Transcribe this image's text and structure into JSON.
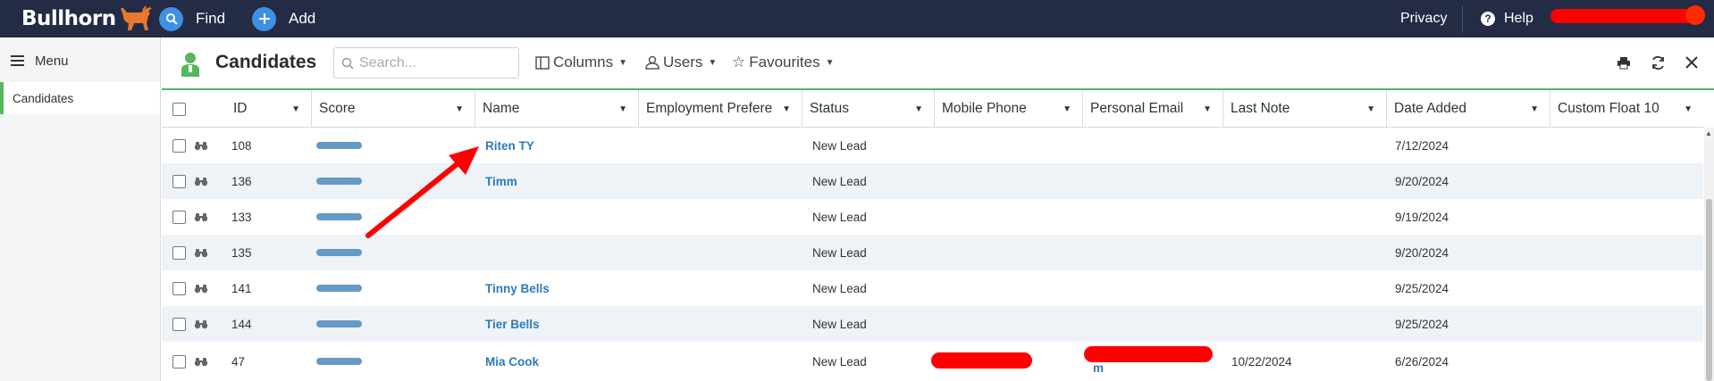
{
  "topbar": {
    "logo_text": "Bullhorn",
    "find_label": "Find",
    "add_label": "Add",
    "privacy_label": "Privacy",
    "help_label": "Help",
    "bg_color": "#232b45",
    "action_circle_color": "#3f8fe3"
  },
  "sidebar": {
    "menu_label": "Menu",
    "items": [
      {
        "label": "Candidates",
        "active": true
      }
    ],
    "active_color": "#55b85b"
  },
  "header": {
    "title": "Candidates",
    "search_placeholder": "Search...",
    "columns_label": "Columns",
    "users_label": "Users",
    "favourites_label": "Favourites"
  },
  "table": {
    "columns": [
      "ID",
      "Score",
      "Name",
      "Employment Prefere",
      "Status",
      "Mobile Phone",
      "Personal Email",
      "Last Note",
      "Date Added",
      "Custom Float 10"
    ],
    "rows": [
      {
        "id": "108",
        "name": "Riten TY",
        "status": "New Lead",
        "last_note": "",
        "date_added": "7/12/2024"
      },
      {
        "id": "136",
        "name": "Timm",
        "status": "New Lead",
        "last_note": "",
        "date_added": "9/20/2024"
      },
      {
        "id": "133",
        "name": "",
        "status": "New Lead",
        "last_note": "",
        "date_added": "9/19/2024"
      },
      {
        "id": "135",
        "name": "",
        "status": "New Lead",
        "last_note": "",
        "date_added": "9/20/2024"
      },
      {
        "id": "141",
        "name": "Tinny Bells",
        "status": "New Lead",
        "last_note": "",
        "date_added": "9/25/2024"
      },
      {
        "id": "144",
        "name": "Tier Bells",
        "status": "New Lead",
        "last_note": "",
        "date_added": "9/25/2024"
      },
      {
        "id": "47",
        "name": "Mia Cook",
        "status": "New Lead",
        "last_note": "10/22/2024",
        "date_added": "6/26/2024"
      }
    ],
    "email_fragment": "m",
    "link_color": "#2e7ab8",
    "score_bar_color": "#6699c4",
    "alt_row_color": "#eef3f8"
  },
  "annotation": {
    "arrow_color": "#ff0000",
    "redaction_color": "#ff0000"
  }
}
